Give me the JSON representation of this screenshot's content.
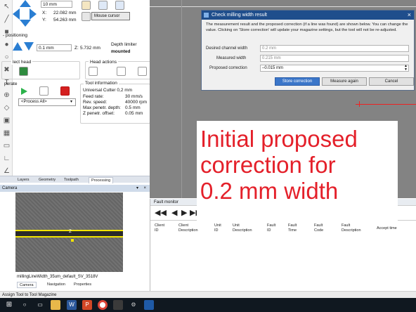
{
  "tool_strip_icons": [
    "arrow-icon",
    "square-icon",
    "circle-icon",
    "circle-icon",
    "cross-icon",
    "text-icon",
    "crosshair-icon",
    "layers-icon",
    "camera-icon",
    "measure-icon",
    "cube-icon",
    "ruler-icon",
    "ruler-icon",
    "angle-icon"
  ],
  "positioning": {
    "step_value": "10 mm",
    "x_label": "X:",
    "x_value": "22.082 mm",
    "y_label": "Y:",
    "y_value": "54.263 mm",
    "mouse_cursor_label": "Mouse cursor",
    "section_label": "- positioning",
    "z_step_value": "0.1 mm",
    "z_label": "Z:",
    "z_value": "5.732 mm",
    "depth_limiter_label": "Depth limiter",
    "depth_limiter_status": "mounted"
  },
  "select_head": {
    "label": "lect head"
  },
  "head_actions": {
    "label": "Head actions"
  },
  "operate": {
    "label": "perate",
    "process_select": "<Process All>"
  },
  "tool_information": {
    "label": "Tool information",
    "tool_name": "Universal Cutter 0,2 mm",
    "rows": [
      {
        "key": "Feed rate:",
        "value": "30 mm/s"
      },
      {
        "key": "Rev. speed:",
        "value": "40000 rpm"
      },
      {
        "key": "Max penetr. depth:",
        "value": "0.5 mm"
      },
      {
        "key": "Z penetr. offset:",
        "value": "0.05 mm"
      }
    ]
  },
  "panel_tabs": [
    "Layers",
    "Geometry",
    "Toolpath",
    "Processing"
  ],
  "camera": {
    "title": "Camera",
    "overlay_number": "2",
    "image_caption": "millingLineWidth_35um_default_SV_3518V"
  },
  "bottom_tabs": [
    "Camera",
    "Navigation",
    "Properties"
  ],
  "dialog": {
    "title": "Check milling width result",
    "message": "The measurement result and the proposed correction (if a line was found) are shown below. You can change the value. Clicking on 'Store correction' will update your magazine settings, but the tool will not be re-adjusted.",
    "fields": [
      {
        "label": "Desired channel width",
        "value": "0.2 mm"
      },
      {
        "label": "Measured width",
        "value": "0.215 mm"
      },
      {
        "label": "Proposed correction",
        "value": "–0.015 mm"
      }
    ],
    "buttons": {
      "store": "Store correction",
      "measure": "Measure again",
      "cancel": "Cancel"
    },
    "close_glyph": "×"
  },
  "annotation": {
    "lines": [
      "Initial proposed",
      "correction for",
      "0.2 mm width"
    ]
  },
  "fault_monitor": {
    "title": "Fault monitor",
    "columns": [
      [
        "Client",
        "ID"
      ],
      [
        "Client",
        "Description"
      ],
      [
        "Unit",
        "ID"
      ],
      [
        "Unit",
        "Description"
      ],
      [
        "Fault",
        "ID"
      ],
      [
        "Fault",
        "Time"
      ],
      [
        "Fault",
        "Code"
      ],
      [
        "Fault",
        "Description"
      ],
      [
        "Accept time",
        ""
      ]
    ]
  },
  "status_bar": {
    "text": "Assign Tool to Tool Magazine"
  },
  "taskbar_icons": [
    "windows-start-icon",
    "search-icon",
    "task-view-icon",
    "file-explorer-icon",
    "word-icon",
    "powerpoint-icon",
    "chrome-icon",
    "app-icon",
    "settings-icon",
    "app-icon"
  ],
  "colors": {
    "annotation_red": "#e4202a",
    "dialog_titlebar": "#1f4e8c",
    "primary_button": "#3b76c9",
    "camera_line": "#f2e400",
    "canvas_grey": "#838383"
  }
}
